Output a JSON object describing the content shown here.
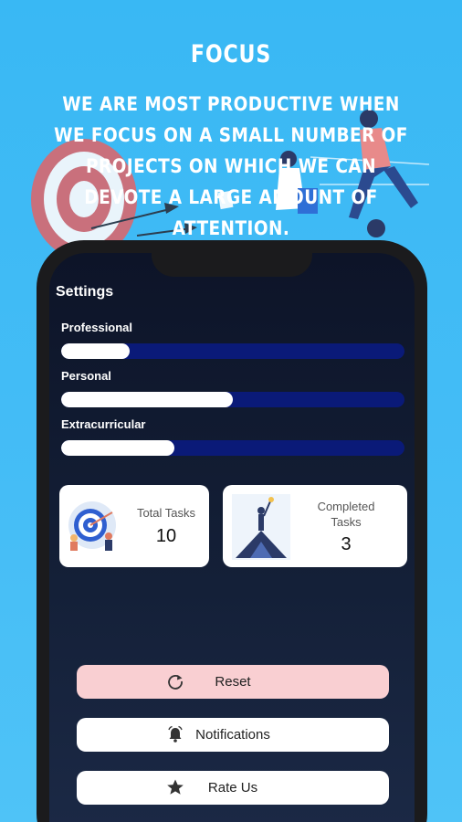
{
  "promo": {
    "title": "FOCUS",
    "text": "WE ARE MOST PRODUCTIVE WHEN WE FOCUS ON A SMALL NUMBER OF PROJECTS ON WHICH WE CAN DEVOTE A LARGE AMOUNT OF ATTENTION."
  },
  "settings": {
    "title": "Settings",
    "progress": [
      {
        "label": "Professional",
        "value": 0.2
      },
      {
        "label": "Personal",
        "value": 0.5
      },
      {
        "label": "Extracurricular",
        "value": 0.33
      }
    ]
  },
  "stats": {
    "total": {
      "label": "Total Tasks",
      "value": "10",
      "illustration": "target-icon"
    },
    "completed": {
      "label": "Completed Tasks",
      "value": "3",
      "illustration": "summit-icon"
    }
  },
  "buttons": {
    "reset": {
      "label": "Reset",
      "icon": "refresh-icon"
    },
    "notifications": {
      "label": "Notifications",
      "icon": "alarm-bell-icon"
    },
    "rate": {
      "label": "Rate Us",
      "icon": "star-icon"
    }
  },
  "colors": {
    "background": "#39b8f4",
    "progress_track": "#0a1a78",
    "progress_fill": "#ffffff",
    "reset_button": "#f9cfd2"
  }
}
